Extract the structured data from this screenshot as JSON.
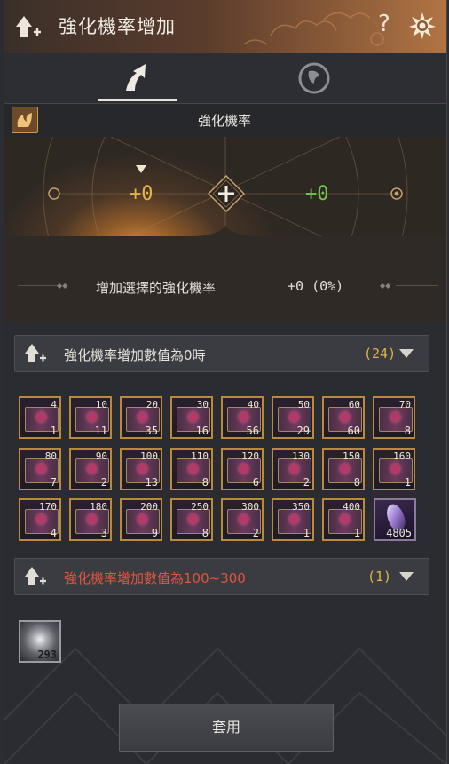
{
  "window": {
    "title": "強化機率增加",
    "help_label": "?"
  },
  "tabs": [
    {
      "name": "enhance",
      "active": true
    },
    {
      "name": "other",
      "active": false
    }
  ],
  "enhance": {
    "header_title": "強化機率",
    "current_value": "+0",
    "result_value": "+0",
    "rate_label": "增加選擇的強化機率",
    "rate_value": "+0 (0%)"
  },
  "group1": {
    "title": "強化機率增加數值為0時",
    "count": "(24)",
    "items": [
      {
        "level": "4",
        "qty": "1"
      },
      {
        "level": "10",
        "qty": "11"
      },
      {
        "level": "20",
        "qty": "35"
      },
      {
        "level": "30",
        "qty": "16"
      },
      {
        "level": "40",
        "qty": "56"
      },
      {
        "level": "50",
        "qty": "29"
      },
      {
        "level": "60",
        "qty": "60"
      },
      {
        "level": "70",
        "qty": "8"
      },
      {
        "level": "80",
        "qty": "7"
      },
      {
        "level": "90",
        "qty": "2"
      },
      {
        "level": "100",
        "qty": "13"
      },
      {
        "level": "110",
        "qty": "8"
      },
      {
        "level": "120",
        "qty": "6"
      },
      {
        "level": "130",
        "qty": "2"
      },
      {
        "level": "150",
        "qty": "8"
      },
      {
        "level": "160",
        "qty": "1"
      },
      {
        "level": "170",
        "qty": "4"
      },
      {
        "level": "180",
        "qty": "3"
      },
      {
        "level": "200",
        "qty": "9"
      },
      {
        "level": "250",
        "qty": "8"
      },
      {
        "level": "300",
        "qty": "2"
      },
      {
        "level": "350",
        "qty": "1"
      },
      {
        "level": "400",
        "qty": "1"
      }
    ],
    "crystal_qty": "4805"
  },
  "group2": {
    "title": "強化機率增加數值為100~300",
    "count": "(1)",
    "item_qty": "293"
  },
  "apply_label": "套用",
  "colors": {
    "accent_gold": "#e2b348",
    "green": "#74c74a",
    "red_title": "#e0553c"
  }
}
